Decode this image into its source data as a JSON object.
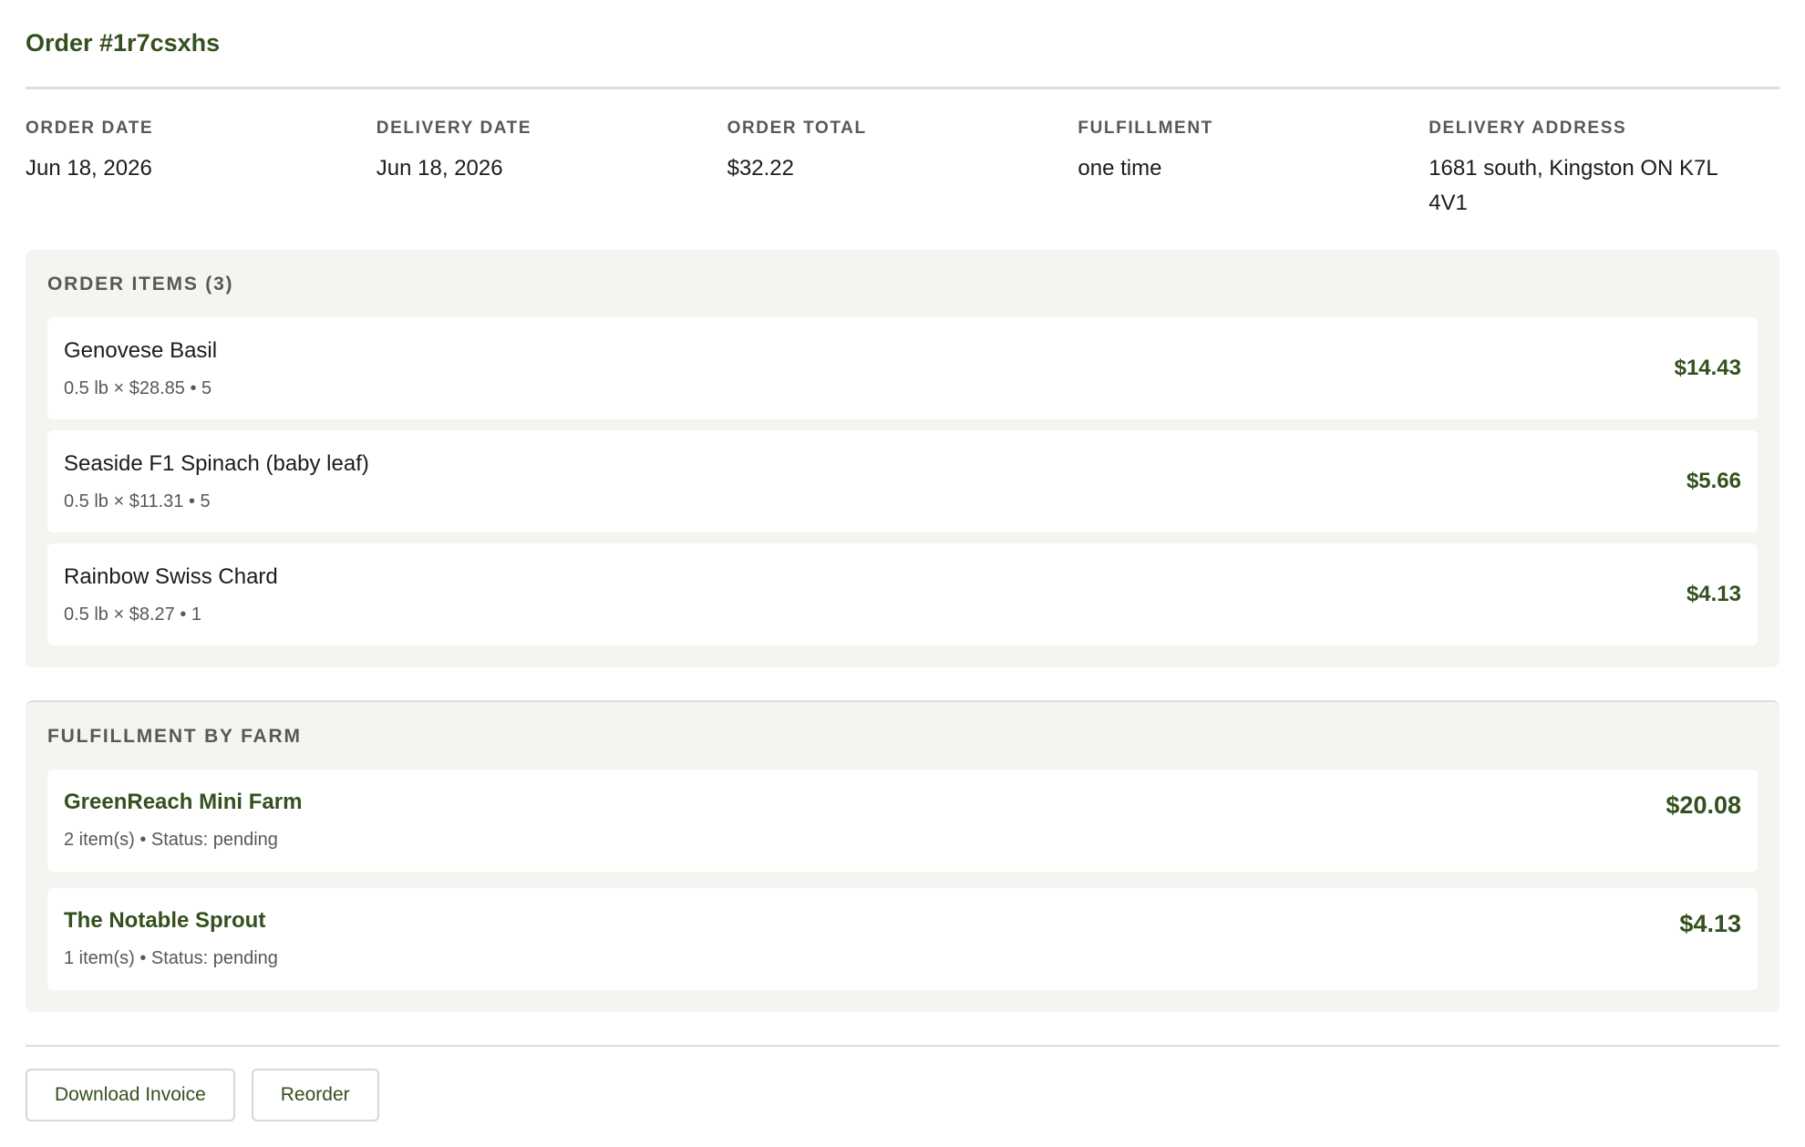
{
  "order": {
    "title": "Order #1r7csxhs"
  },
  "meta": [
    {
      "label": "ORDER DATE",
      "value": "Jun 18, 2026"
    },
    {
      "label": "DELIVERY DATE",
      "value": "Jun 18, 2026"
    },
    {
      "label": "ORDER TOTAL",
      "value": "$32.22"
    },
    {
      "label": "FULFILLMENT",
      "value": "one time"
    },
    {
      "label": "DELIVERY ADDRESS",
      "value": "1681 south, Kingston ON K7L 4V1"
    }
  ],
  "items": {
    "heading": "ORDER ITEMS (3)",
    "list": [
      {
        "name": "Genovese Basil",
        "detail": "0.5 lb × $28.85 • 5",
        "price": "$14.43"
      },
      {
        "name": "Seaside F1 Spinach (baby leaf)",
        "detail": "0.5 lb × $11.31 • 5",
        "price": "$5.66"
      },
      {
        "name": "Rainbow Swiss Chard",
        "detail": "0.5 lb × $8.27 • 1",
        "price": "$4.13"
      }
    ]
  },
  "farms": {
    "heading": "FULFILLMENT BY FARM",
    "list": [
      {
        "name": "GreenReach Mini Farm",
        "detail": "2 item(s) • Status: pending",
        "price": "$20.08"
      },
      {
        "name": "The Notable Sprout",
        "detail": "1 item(s) • Status: pending",
        "price": "$4.13"
      }
    ]
  },
  "actions": {
    "download_label": "Download Invoice",
    "reorder_label": "Reorder"
  },
  "colors": {
    "accent": "#34501e",
    "panel_bg": "#f4f5f1",
    "muted_text": "#555a52"
  }
}
